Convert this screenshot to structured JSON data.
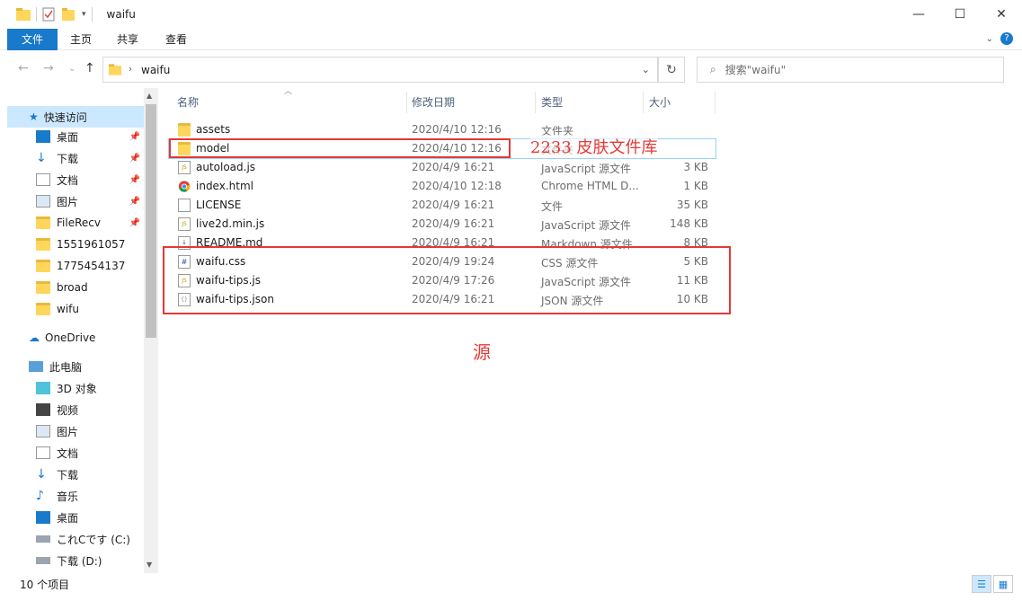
{
  "window": {
    "title": "waifu"
  },
  "ribbon": {
    "tabs": [
      {
        "label": "文件"
      },
      {
        "label": "主页"
      },
      {
        "label": "共享"
      },
      {
        "label": "查看"
      }
    ]
  },
  "address": {
    "path": "waifu"
  },
  "search": {
    "placeholder": "搜索\"waifu\""
  },
  "nav": {
    "quick_access": "快速访问",
    "items": [
      {
        "label": "桌面",
        "icon": "desktop-icon"
      },
      {
        "label": "下载",
        "icon": "download-icon"
      },
      {
        "label": "文档",
        "icon": "document-icon"
      },
      {
        "label": "图片",
        "icon": "picture-icon"
      },
      {
        "label": "FileRecv",
        "icon": "folder-icon"
      },
      {
        "label": "1551961057",
        "icon": "folder-icon"
      },
      {
        "label": "1775454137",
        "icon": "folder-icon"
      },
      {
        "label": "broad",
        "icon": "folder-icon"
      },
      {
        "label": "wifu",
        "icon": "folder-icon"
      }
    ],
    "onedrive": "OneDrive",
    "this_pc": "此电脑",
    "pc_items": [
      {
        "label": "3D 对象",
        "icon": "3d-objects-icon"
      },
      {
        "label": "视频",
        "icon": "video-icon"
      },
      {
        "label": "图片",
        "icon": "picture-icon"
      },
      {
        "label": "文档",
        "icon": "document-icon"
      },
      {
        "label": "下载",
        "icon": "download-icon"
      },
      {
        "label": "音乐",
        "icon": "music-icon"
      },
      {
        "label": "桌面",
        "icon": "desktop-icon"
      },
      {
        "label": "これCです (C:)",
        "icon": "drive-icon"
      },
      {
        "label": "下载 (D:)",
        "icon": "drive-icon"
      }
    ]
  },
  "columns": {
    "name": "名称",
    "date": "修改日期",
    "type": "类型",
    "size": "大小"
  },
  "files": [
    {
      "name": "assets",
      "date": "2020/4/10 12:16",
      "type": "文件夹",
      "size": "",
      "icon": "folder-icon"
    },
    {
      "name": "model",
      "date": "2020/4/10 12:16",
      "type": "文件夹",
      "size": "",
      "icon": "folder-icon"
    },
    {
      "name": "autoload.js",
      "date": "2020/4/9 16:21",
      "type": "JavaScript 源文件",
      "size": "3 KB",
      "icon": "js-file-icon"
    },
    {
      "name": "index.html",
      "date": "2020/4/10 12:18",
      "type": "Chrome HTML D...",
      "size": "1 KB",
      "icon": "chrome-icon"
    },
    {
      "name": "LICENSE",
      "date": "2020/4/9 16:21",
      "type": "文件",
      "size": "35 KB",
      "icon": "file-icon"
    },
    {
      "name": "live2d.min.js",
      "date": "2020/4/9 16:21",
      "type": "JavaScript 源文件",
      "size": "148 KB",
      "icon": "js-file-icon"
    },
    {
      "name": "README.md",
      "date": "2020/4/9 16:21",
      "type": "Markdown 源文件",
      "size": "8 KB",
      "icon": "md-file-icon"
    },
    {
      "name": "waifu.css",
      "date": "2020/4/9 19:24",
      "type": "CSS 源文件",
      "size": "5 KB",
      "icon": "css-file-icon"
    },
    {
      "name": "waifu-tips.js",
      "date": "2020/4/9 17:26",
      "type": "JavaScript 源文件",
      "size": "11 KB",
      "icon": "js-file-icon"
    },
    {
      "name": "waifu-tips.json",
      "date": "2020/4/9 16:21",
      "type": "JSON 源文件",
      "size": "10 KB",
      "icon": "json-file-icon"
    }
  ],
  "annotations": {
    "skin_library": "2233 皮肤文件库",
    "source": "源"
  },
  "status": {
    "count": "10 个项目"
  },
  "colors": {
    "accent": "#1979ca",
    "annotation": "#e53935",
    "selection": "#cce8ff"
  }
}
